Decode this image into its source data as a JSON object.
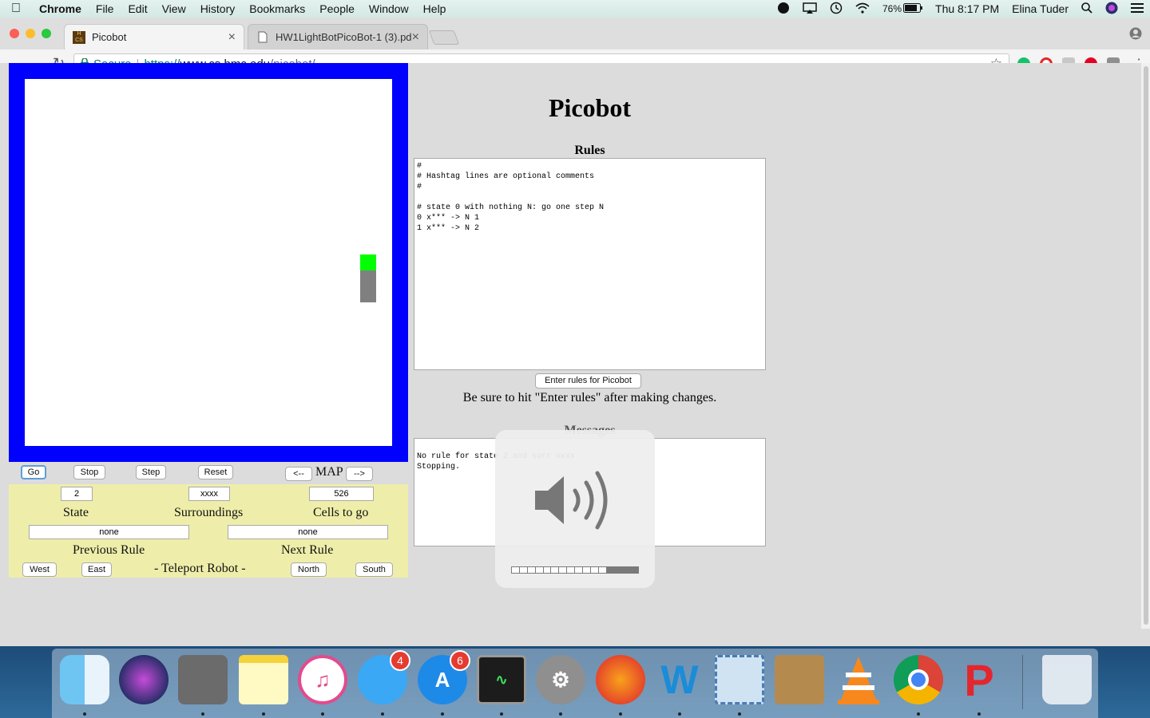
{
  "menubar": {
    "app": "Chrome",
    "items": [
      "File",
      "Edit",
      "View",
      "History",
      "Bookmarks",
      "People",
      "Window",
      "Help"
    ],
    "battery": "76%",
    "clock": "Thu 8:17 PM",
    "user": "Elina Tuder"
  },
  "browser": {
    "tabs": [
      {
        "title": "Picobot",
        "active": true
      },
      {
        "title": "HW1LightBotPicoBot-1 (3).pd",
        "active": false
      }
    ],
    "url": {
      "secure_label": "Secure",
      "scheme": "https://",
      "host": "www.cs.hmc.edu",
      "path": "/picobot/"
    }
  },
  "picobot": {
    "title": "Picobot",
    "controls": {
      "go": "Go",
      "stop": "Stop",
      "step": "Step",
      "reset": "Reset",
      "map_prev": "<--",
      "map_label": "MAP",
      "map_next": "-->"
    },
    "state_value": "2",
    "surroundings_value": "xxxx",
    "cells_to_go_value": "526",
    "state_label": "State",
    "surroundings_label": "Surroundings",
    "cells_to_go_label": "Cells to go",
    "previous_rule_value": "none",
    "next_rule_value": "none",
    "previous_rule_label": "Previous Rule",
    "next_rule_label": "Next Rule",
    "teleport": {
      "west": "West",
      "east": "East",
      "label": "- Teleport Robot -",
      "north": "North",
      "south": "South"
    },
    "rules_heading": "Rules",
    "rules_text": "#\n# Hashtag lines are optional comments\n#\n\n# state 0 with nothing N: go one step N\n0 x*** -> N 1\n1 x*** -> N 2",
    "enter_rules_button": "Enter rules for Picobot",
    "reminder": "Be sure to hit \"Enter rules\" after making changes.",
    "messages_heading": "Messages",
    "messages_text": "No rule for state 2 and surr xxxx\nStopping."
  },
  "volume_hud": {
    "level": 0.75,
    "segments": 16
  },
  "dock": {
    "items": [
      {
        "name": "finder",
        "badge": null
      },
      {
        "name": "siri",
        "badge": null
      },
      {
        "name": "calculator",
        "badge": null
      },
      {
        "name": "notes",
        "badge": null
      },
      {
        "name": "itunes",
        "badge": null
      },
      {
        "name": "messages",
        "badge": "4"
      },
      {
        "name": "app-store",
        "badge": "6"
      },
      {
        "name": "activity-monitor",
        "badge": null
      },
      {
        "name": "system-preferences",
        "badge": null
      },
      {
        "name": "firefox",
        "badge": null
      },
      {
        "name": "word",
        "badge": null
      },
      {
        "name": "mail",
        "badge": null
      },
      {
        "name": "contacts",
        "badge": null
      },
      {
        "name": "vlc",
        "badge": null
      },
      {
        "name": "chrome",
        "badge": null
      },
      {
        "name": "wps",
        "badge": null
      },
      {
        "name": "trash",
        "badge": null
      }
    ]
  },
  "colors": {
    "arena_border": "#0000ff",
    "robot": "#00ff00",
    "trail": "#808080",
    "control_panel": "#eeeeaa"
  }
}
